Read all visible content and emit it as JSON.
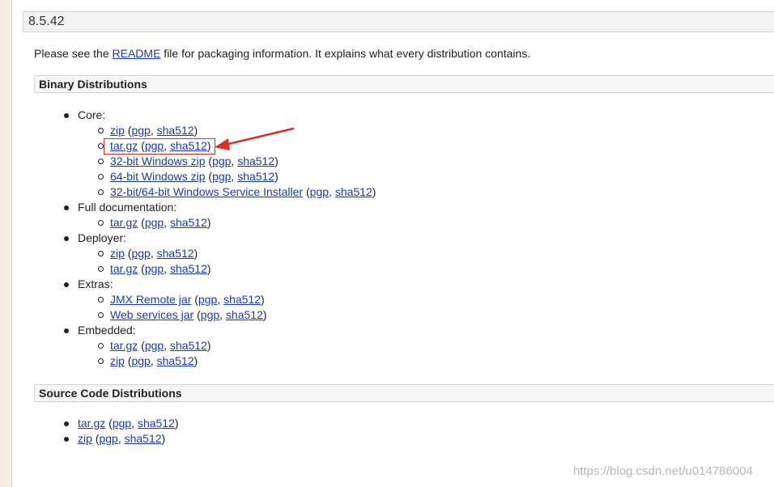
{
  "version": "8.5.42",
  "intro": {
    "before": "Please see the ",
    "link": "README",
    "after": " file for packaging information. It explains what every distribution contains."
  },
  "binary": {
    "title": "Binary Distributions",
    "core": {
      "label": "Core:",
      "items": [
        {
          "name": "zip",
          "pgp": "pgp",
          "sha": "sha512"
        },
        {
          "name": "tar.gz",
          "pgp": "pgp",
          "sha": "sha512"
        },
        {
          "name": "32-bit Windows zip",
          "pgp": "pgp",
          "sha": "sha512"
        },
        {
          "name": "64-bit Windows zip",
          "pgp": "pgp",
          "sha": "sha512"
        },
        {
          "name": "32-bit/64-bit Windows Service Installer",
          "pgp": "pgp",
          "sha": "sha512"
        }
      ]
    },
    "fulldoc": {
      "label": "Full documentation:",
      "items": [
        {
          "name": "tar.gz",
          "pgp": "pgp",
          "sha": "sha512"
        }
      ]
    },
    "deployer": {
      "label": "Deployer:",
      "items": [
        {
          "name": "zip",
          "pgp": "pgp",
          "sha": "sha512"
        },
        {
          "name": "tar.gz",
          "pgp": "pgp",
          "sha": "sha512"
        }
      ]
    },
    "extras": {
      "label": "Extras:",
      "items": [
        {
          "name": "JMX Remote jar",
          "pgp": "pgp",
          "sha": "sha512"
        },
        {
          "name": "Web services jar",
          "pgp": "pgp",
          "sha": "sha512"
        }
      ]
    },
    "embedded": {
      "label": "Embedded:",
      "items": [
        {
          "name": "tar.gz",
          "pgp": "pgp",
          "sha": "sha512"
        },
        {
          "name": "zip",
          "pgp": "pgp",
          "sha": "sha512"
        }
      ]
    }
  },
  "source": {
    "title": "Source Code Distributions",
    "items": [
      {
        "name": "tar.gz",
        "pgp": "pgp",
        "sha": "sha512"
      },
      {
        "name": "zip",
        "pgp": "pgp",
        "sha": "sha512"
      }
    ]
  },
  "punct": {
    "open": " (",
    "sep": ", ",
    "close": ")"
  },
  "annotation": {
    "color": "#d9302a"
  },
  "watermark": "https://blog.csdn.net/u014786004"
}
